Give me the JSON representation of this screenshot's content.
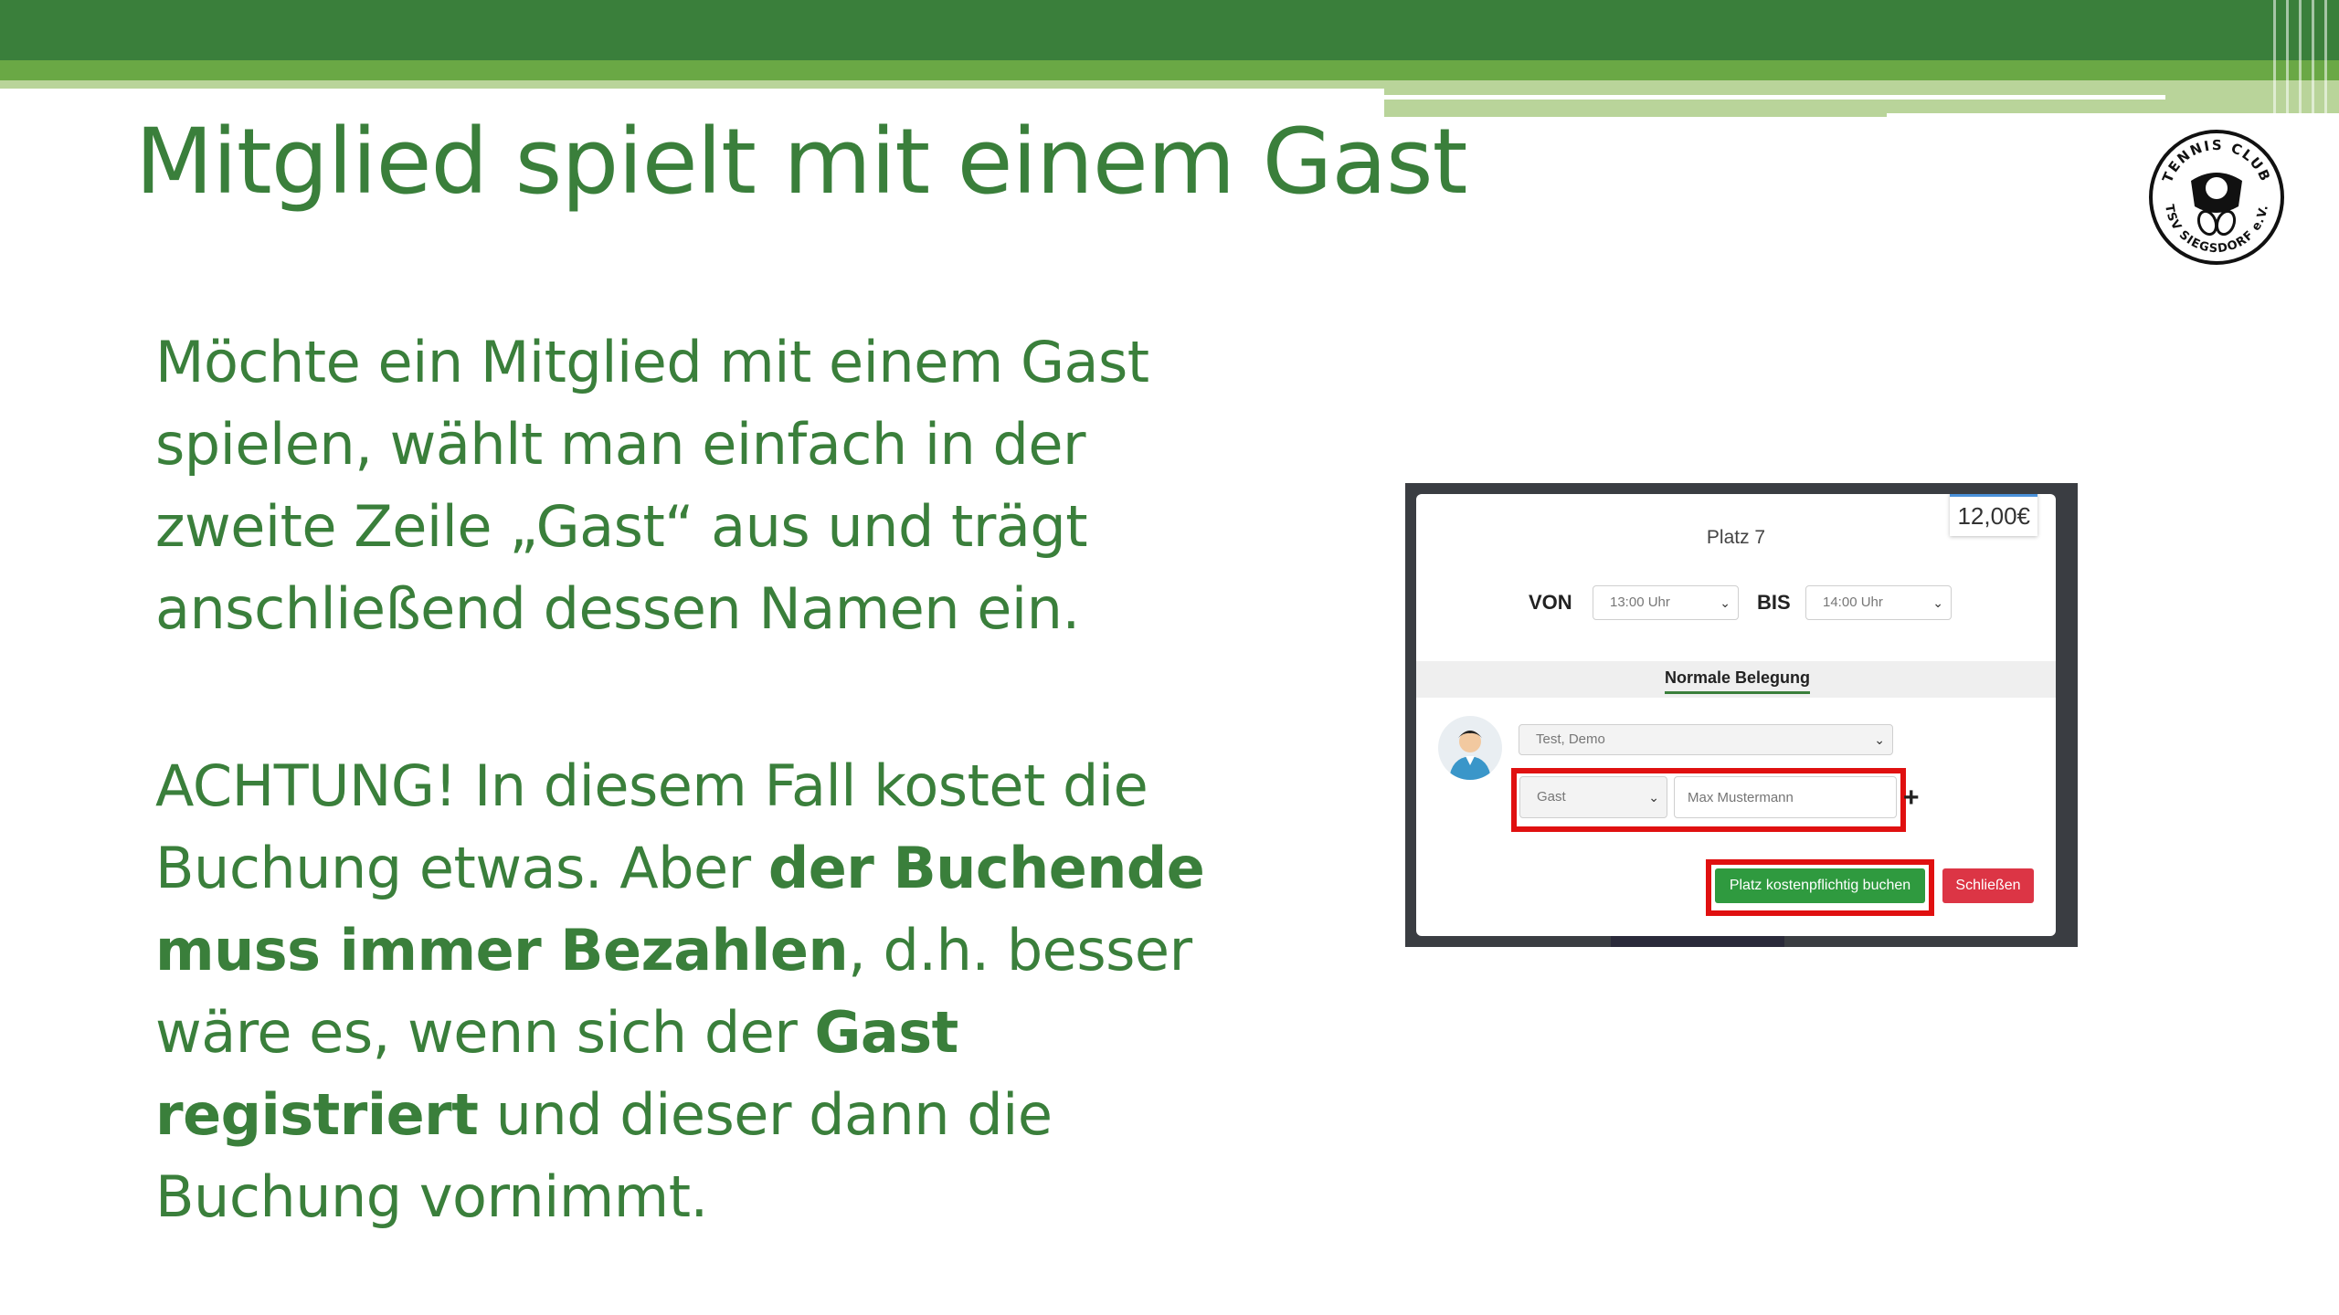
{
  "slide": {
    "title": "Mitglied spielt mit einem Gast",
    "paragraph1": "Möchte ein Mitglied mit einem Gast spielen, wählt man einfach in der zweite Zeile „Gast“ aus und trägt anschließend dessen Namen ein.",
    "paragraph2": {
      "t1": "ACHTUNG! In diesem Fall kostet die Buchung etwas. Aber ",
      "b1": "der Buchende muss immer Bezahlen",
      "t2": ", d.h. besser wäre es, wenn sich der ",
      "b2": "Gast registriert",
      "t3": " und dieser dann die Buchung vornimmt."
    },
    "colors": {
      "accent": "#3a7f3b",
      "bar_mid": "#6aa845",
      "bar_light": "#b9d49a",
      "highlight": "#e01010"
    }
  },
  "logo": {
    "icon": "tennis-club-logo",
    "text_top": "TENNIS CLUB",
    "text_bottom": "TSV SIEGSDORF e.V."
  },
  "booking": {
    "price": "12,00€",
    "court": "Platz 7",
    "from_label": "VON",
    "from_value": "13:00 Uhr",
    "to_label": "BIS",
    "to_value": "14:00 Uhr",
    "tab": "Normale Belegung",
    "player1": "Test, Demo",
    "player2_type": "Gast",
    "player2_name_placeholder": "Max Mustermann",
    "add_symbol": "+",
    "book_button": "Platz kostenpflichtig buchen",
    "close_button": "Schließen"
  }
}
